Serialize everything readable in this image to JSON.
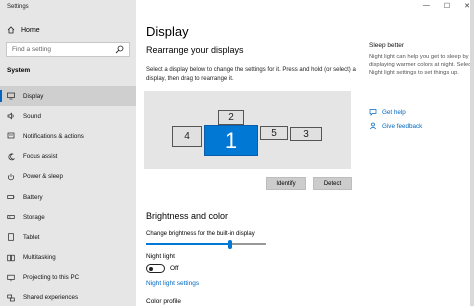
{
  "window": {
    "title": "Settings",
    "controls": [
      "—",
      "☐",
      "✕"
    ]
  },
  "sidebar": {
    "home_label": "Home",
    "search_placeholder": "Find a setting",
    "section_label": "System",
    "items": [
      {
        "label": "Display",
        "icon": "monitor-icon",
        "active": true
      },
      {
        "label": "Sound",
        "icon": "speaker-icon"
      },
      {
        "label": "Notifications & actions",
        "icon": "notification-icon"
      },
      {
        "label": "Focus assist",
        "icon": "moon-icon"
      },
      {
        "label": "Power & sleep",
        "icon": "power-icon"
      },
      {
        "label": "Battery",
        "icon": "battery-icon"
      },
      {
        "label": "Storage",
        "icon": "storage-icon"
      },
      {
        "label": "Tablet",
        "icon": "tablet-icon"
      },
      {
        "label": "Multitasking",
        "icon": "multitasking-icon"
      },
      {
        "label": "Projecting to this PC",
        "icon": "projecting-icon"
      },
      {
        "label": "Shared experiences",
        "icon": "shared-icon"
      }
    ]
  },
  "main": {
    "page_title": "Display",
    "rearrange_title": "Rearrange your displays",
    "rearrange_desc": "Select a display below to change the settings for it. Press and hold (or select) a display, then drag to rearrange it.",
    "monitors": [
      {
        "label": "1",
        "active": true
      },
      {
        "label": "2"
      },
      {
        "label": "3"
      },
      {
        "label": "4"
      },
      {
        "label": "5"
      }
    ],
    "identify_label": "Identify",
    "detect_label": "Detect",
    "brightness_title": "Brightness and color",
    "brightness_label": "Change brightness for the built-in display",
    "brightness_value": 0.7,
    "night_light_label": "Night light",
    "night_light_state": "Off",
    "night_light_settings_link": "Night light settings",
    "color_profile_label": "Color profile"
  },
  "right_pane": {
    "title": "Sleep better",
    "description": "Night light can help you get to sleep by displaying warmer colors at night. Select Night light settings to set things up.",
    "get_help": "Get help",
    "give_feedback": "Give feedback"
  },
  "colors": {
    "accent": "#0078d4",
    "link": "#0067c0",
    "sidebar_bg": "#e6e6e6"
  }
}
